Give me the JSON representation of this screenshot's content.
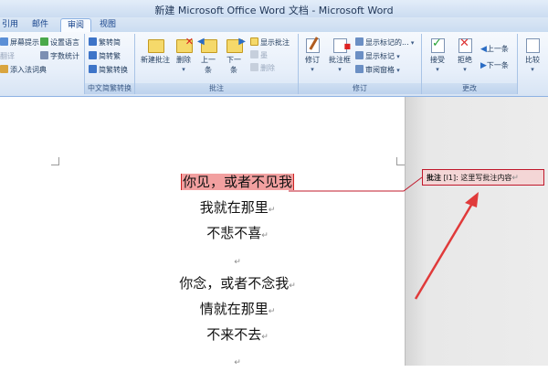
{
  "window": {
    "title": "新建 Microsoft Office Word 文档 - Microsoft Word"
  },
  "tabs": [
    "引用",
    "邮件",
    "审阅",
    "视图"
  ],
  "active_tab": "审阅",
  "groups": {
    "proofing": {
      "items": [
        "屏幕提示",
        "设置语言",
        "字数统计",
        "添入法词典",
        "翻译"
      ]
    },
    "chinese_convert": {
      "label": "中文简繁转换",
      "items": [
        "繁转简",
        "简转繁",
        "简繁转换"
      ]
    },
    "comments": {
      "label": "批注",
      "new": "新建批注",
      "delete": "删除",
      "prev": "上一条",
      "next": "下一条",
      "show_comments": "显示批注",
      "ink": "墨",
      "delete_ink": "删除"
    },
    "tracking": {
      "label": "修订",
      "track": "修订",
      "balloons": "批注框",
      "show_markup": "显示标记的...",
      "show_markup2": "显示标记",
      "review_pane": "审阅窗格"
    },
    "changes": {
      "label": "更改",
      "accept": "接受",
      "reject": "拒绝",
      "prev": "上一条",
      "next": "下一条"
    },
    "compare": {
      "label": "比较"
    }
  },
  "document": {
    "lines": [
      "你见，或者不见我",
      "我就在那里",
      "不悲不喜",
      "你念，或者不念我",
      "情就在那里",
      "不来不去"
    ],
    "highlighted_line": "你见，或者不见我"
  },
  "comment": {
    "label": "批注",
    "author_tag": "[l1]:",
    "text": "这里写批注内容"
  },
  "colors": {
    "comment_highlight": "#f2a0a0",
    "comment_border": "#c0182b",
    "annotation_arrow": "#e03a3a"
  }
}
